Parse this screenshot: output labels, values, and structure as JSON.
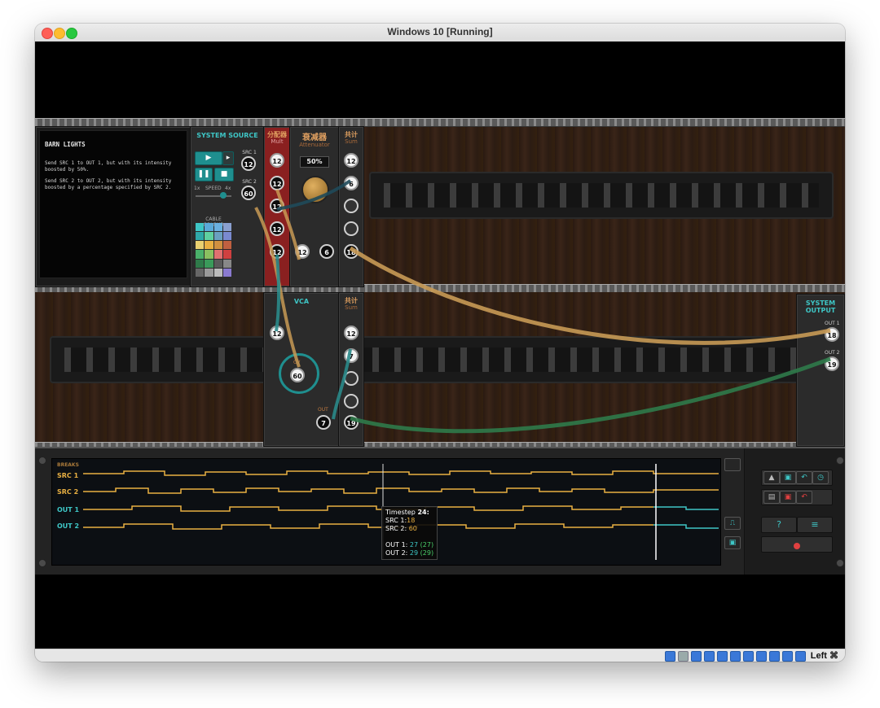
{
  "window": {
    "title": "Windows 10 [Running]",
    "host_key": "Left ⌘"
  },
  "puzzle": {
    "title": "BARN LIGHTS",
    "lines": [
      "Send SRC 1 to OUT 1, but with its intensity",
      "boosted by 50%.",
      "Send SRC 2 to OUT 2, but with its intensity",
      "boosted by a percentage specified by SRC 2."
    ]
  },
  "source": {
    "title": "SYSTEM SOURCE",
    "speed_label": "SPEED",
    "speed_min": "1x",
    "speed_max": "4x",
    "cable_colour_label": "CABLE COLOUR",
    "src1_label": "SRC 1",
    "src1_value": "12",
    "src2_label": "SRC 2",
    "src2_value": "60",
    "play_icon": "play-icon",
    "step_icon": "step-forward-icon",
    "pause_icon": "pause-icon",
    "stop_icon": "stop-icon"
  },
  "mult": {
    "title_cn": "分配器",
    "title": "Mult",
    "in_label": "IN",
    "out_label": "OUT",
    "values": [
      "12",
      "12",
      "12",
      "12",
      "12"
    ]
  },
  "attenuator": {
    "title_cn": "衰减器",
    "title": "Attenuator",
    "display": "50%",
    "in_label": "输入 IN",
    "out_label": "输出 OUT",
    "in_value": "12",
    "out_value": "6"
  },
  "sum1": {
    "title_cn": "共计",
    "title": "Sum",
    "in1_label": "IN 1",
    "in2_label": "IN 2",
    "in3_label": "IN 3",
    "in4_label": "IN 4",
    "out_label": "OUT",
    "in1": "12",
    "in2": "6",
    "out": "18"
  },
  "vca": {
    "title": "VCA",
    "in_value": "12",
    "cv_label": "CV",
    "cv_value": "60",
    "out_label": "OUT",
    "out_value": "7"
  },
  "sum2": {
    "title_cn": "共计",
    "title": "Sum",
    "in1_label": "IN 1",
    "in2_label": "IN 2",
    "in3_label": "IN 3",
    "in4_label": "IN 4",
    "out_label": "OUT",
    "in1": "12",
    "in2": "7",
    "out": "19"
  },
  "system_output": {
    "title": "SYSTEM OUTPUT",
    "out1_label": "OUT 1",
    "out1": "18",
    "out2_label": "OUT 2",
    "out2": "19"
  },
  "sequencer": {
    "breaks_label": "BREAKS",
    "rows": [
      "SRC 1",
      "SRC 2",
      "OUT 1",
      "OUT 2"
    ],
    "tooltip": {
      "timestep_label": "Timestep",
      "timestep": "24:",
      "src1_label": "SRC 1:",
      "src1": "18",
      "src2_label": "SRC 2:",
      "src2": "60",
      "out1_label": "OUT 1:",
      "out1": "27",
      "out1_expected": "(27)",
      "out2_label": "OUT 2:",
      "out2": "29",
      "out2_expected": "(29)"
    }
  },
  "colors": {
    "src": "#e9b042",
    "out": "#3ec6c6",
    "cable_tan": "#c89a55",
    "cable_teal": "#2a8a8a",
    "cable_green": "#2f7a4a",
    "accent": "#1f8f8f"
  }
}
